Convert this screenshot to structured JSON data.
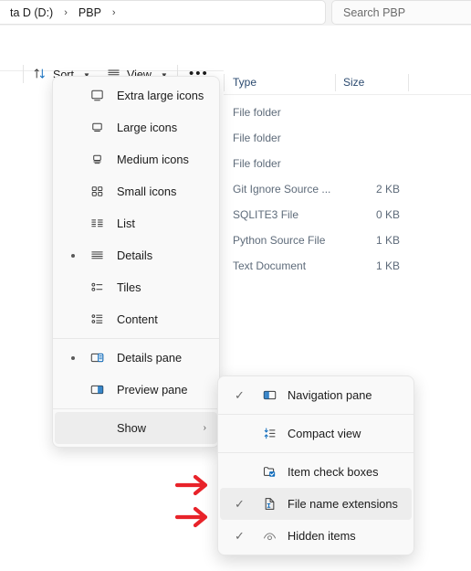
{
  "window": {
    "breadcrumb": {
      "items": [
        "ta D (D:)",
        "PBP"
      ],
      "separator": "›"
    },
    "search": {
      "placeholder": "Search PBP"
    }
  },
  "command_bar": {
    "sort_label": "Sort",
    "view_label": "View",
    "overflow_label": "•••",
    "chevron": "⌄"
  },
  "file_list": {
    "columns": [
      "Type",
      "Size"
    ],
    "rows": [
      {
        "type": "File folder",
        "size": ""
      },
      {
        "type": "File folder",
        "size": ""
      },
      {
        "type": "File folder",
        "size": ""
      },
      {
        "type": "Git Ignore Source ...",
        "size": "2 KB"
      },
      {
        "type": "SQLITE3 File",
        "size": "0 KB"
      },
      {
        "type": "Python Source File",
        "size": "1 KB"
      },
      {
        "type": "Text Document",
        "size": "1 KB"
      }
    ]
  },
  "view_menu": {
    "items": [
      {
        "label": "Extra large icons",
        "icon": "monitor-xl-icon",
        "selected": false
      },
      {
        "label": "Large icons",
        "icon": "monitor-large-icon",
        "selected": false
      },
      {
        "label": "Medium icons",
        "icon": "monitor-medium-icon",
        "selected": false
      },
      {
        "label": "Small icons",
        "icon": "grid-small-icons-icon",
        "selected": false
      },
      {
        "label": "List",
        "icon": "list-icon",
        "selected": false
      },
      {
        "label": "Details",
        "icon": "details-icon",
        "selected": true
      },
      {
        "label": "Tiles",
        "icon": "tiles-icon",
        "selected": false
      },
      {
        "label": "Content",
        "icon": "content-icon",
        "selected": false
      },
      {
        "label": "Details pane",
        "icon": "details-pane-icon",
        "selected": true
      },
      {
        "label": "Preview pane",
        "icon": "preview-pane-icon",
        "selected": false
      },
      {
        "label": "Show",
        "icon": "",
        "selected": false,
        "submenu_chevron": "›",
        "highlighted": true
      }
    ]
  },
  "show_submenu": {
    "items": [
      {
        "label": "Navigation pane",
        "icon": "navigation-pane-icon",
        "checked": true,
        "highlighted": false
      },
      {
        "label": "Compact view",
        "icon": "compact-view-icon",
        "checked": false,
        "highlighted": false
      },
      {
        "label": "Item check boxes",
        "icon": "item-check-boxes-icon",
        "checked": false,
        "highlighted": false
      },
      {
        "label": "File name extensions",
        "icon": "file-name-extensions-icon",
        "checked": true,
        "highlighted": true
      },
      {
        "label": "Hidden items",
        "icon": "hidden-items-icon",
        "checked": true,
        "highlighted": false
      }
    ],
    "check_glyph": "✓"
  },
  "annotations": {
    "arrow_color": "#e8232a",
    "arrows": [
      "arrow-file-name-extensions",
      "arrow-hidden-items"
    ]
  },
  "colors": {
    "accent": "#0f6cbd",
    "highlight": "#ededed",
    "menu_bg": "#f9f9f9"
  }
}
